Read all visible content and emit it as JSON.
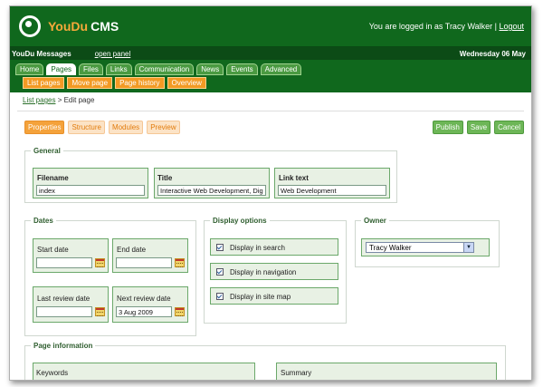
{
  "header": {
    "logo_you": "YouDu",
    "logo_rest": "CMS",
    "login_text": "You are logged in as Tracy Walker |",
    "logout": "Logout"
  },
  "msgbar": {
    "label": "YouDu Messages",
    "open_panel": "open panel",
    "date": "Wednesday 06 May"
  },
  "tabs": [
    {
      "label": "Home"
    },
    {
      "label": "Pages"
    },
    {
      "label": "Files"
    },
    {
      "label": "Links"
    },
    {
      "label": "Communication"
    },
    {
      "label": "News"
    },
    {
      "label": "Events"
    },
    {
      "label": "Advanced"
    }
  ],
  "subtabs": [
    {
      "label": "List pages"
    },
    {
      "label": "Move page"
    },
    {
      "label": "Page history"
    },
    {
      "label": "Overview"
    }
  ],
  "breadcrumb": {
    "link": "List pages",
    "rest": "> Edit page"
  },
  "viewtabs": [
    {
      "label": "Properties"
    },
    {
      "label": "Structure"
    },
    {
      "label": "Modules"
    },
    {
      "label": "Preview"
    }
  ],
  "actions": {
    "publish": "Publish",
    "save": "Save",
    "cancel": "Cancel"
  },
  "general": {
    "legend": "General",
    "filename_label": "Filename",
    "filename_value": "index",
    "title_label": "Title",
    "title_value": "Interactive Web Development, Dig",
    "linktext_label": "Link text",
    "linktext_value": "Web Development"
  },
  "dates": {
    "legend": "Dates",
    "start_label": "Start date",
    "start_value": "",
    "end_label": "End date",
    "end_value": "",
    "lastreview_label": "Last review date",
    "lastreview_value": "",
    "nextreview_label": "Next review date",
    "nextreview_value": "3 Aug 2009"
  },
  "display": {
    "legend": "Display options",
    "search": "Display in search",
    "navigation": "Display in navigation",
    "sitemap": "Display in site map"
  },
  "owner": {
    "legend": "Owner",
    "value": "Tracy Walker"
  },
  "pageinfo": {
    "legend": "Page information",
    "keywords": "Keywords",
    "summary": "Summary"
  }
}
